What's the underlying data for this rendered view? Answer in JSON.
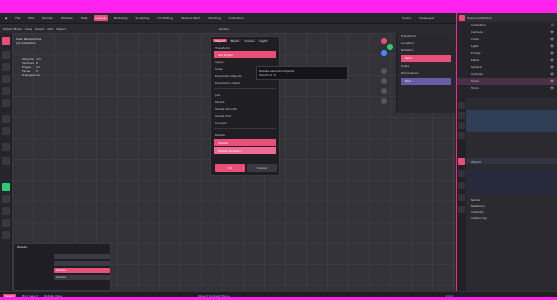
{
  "topbar": {
    "menus": [
      "File",
      "Edit",
      "Render",
      "Window",
      "Help"
    ],
    "workspaces": [
      "Layout",
      "Modeling",
      "Sculpting",
      "UV Editing",
      "Texture Paint",
      "Shading",
      "Animation"
    ],
    "active_workspace": "Layout",
    "scene": "Scene",
    "view_layer": "ViewLayer"
  },
  "header": {
    "mode": "Object Mode",
    "items": [
      "View",
      "Select",
      "Add",
      "Object"
    ],
    "transform": "Global"
  },
  "viewport_info": {
    "line1": "User Perspective",
    "line2": "(1) Collection",
    "stats": [
      {
        "label": "Objects",
        "value": "1/3"
      },
      {
        "label": "Vertices",
        "value": "8"
      },
      {
        "label": "Edges",
        "value": "12"
      },
      {
        "label": "Faces",
        "value": "6"
      },
      {
        "label": "Triangles",
        "value": "12"
      }
    ]
  },
  "menu": {
    "tabs": [
      "Object",
      "Mesh",
      "Curve",
      "Light"
    ],
    "active_tab": "Object",
    "rows": [
      "Transform",
      "Set Origin",
      "Apply",
      "Snap",
      "Duplicate Objects",
      "Duplicate Linked",
      "Join",
      "Parent",
      "Shade Smooth",
      "Shade Flat",
      "Convert",
      "Delete"
    ],
    "highlight_rows": [
      "Delete",
      "Delete Globally"
    ],
    "footer": [
      "Cancel",
      "OK"
    ]
  },
  "tooltip": {
    "text": "Delete selected objects",
    "shortcut": "Shortcut: X"
  },
  "npanel": {
    "title": "Transform",
    "rows": [
      "Location",
      "Rotation",
      "Scale",
      "Dimensions"
    ],
    "pink_row": "Item",
    "sel_row": "Tool"
  },
  "outliner": {
    "title": "Scene Collection",
    "items": [
      {
        "name": "Collection",
        "flag": "☑"
      },
      {
        "name": "Camera",
        "flag": "👁"
      },
      {
        "name": "Cube",
        "flag": "👁"
      },
      {
        "name": "Light",
        "flag": "👁"
      },
      {
        "name": "Empty",
        "flag": "👁"
      },
      {
        "name": "Plane",
        "flag": "👁"
      },
      {
        "name": "Sphere",
        "flag": "👁"
      },
      {
        "name": "Cylinder",
        "flag": "👁"
      },
      {
        "name": "Cone",
        "flag": "👁"
      },
      {
        "name": "Torus",
        "flag": "👁"
      },
      {
        "name": "Monkey",
        "flag": "👁"
      }
    ]
  },
  "properties": {
    "section": "Object",
    "fields": [
      "Name",
      "Relations",
      "Visibility",
      "Instancing"
    ]
  },
  "last_operator": {
    "title": "Delete",
    "fields": [
      {
        "label": "",
        "value": ""
      },
      {
        "label": "",
        "value": ""
      },
      {
        "label": "",
        "value": "Delete"
      },
      {
        "label": "",
        "value": "Global"
      }
    ]
  },
  "statusbar": {
    "left": [
      "Select",
      "Box Select",
      "Rotate View"
    ],
    "center": "Object Context Menu",
    "version": "4.0.2"
  },
  "colors": {
    "accent": "#e8507a",
    "frame": "#ff22ee",
    "panel": "#26252b"
  }
}
